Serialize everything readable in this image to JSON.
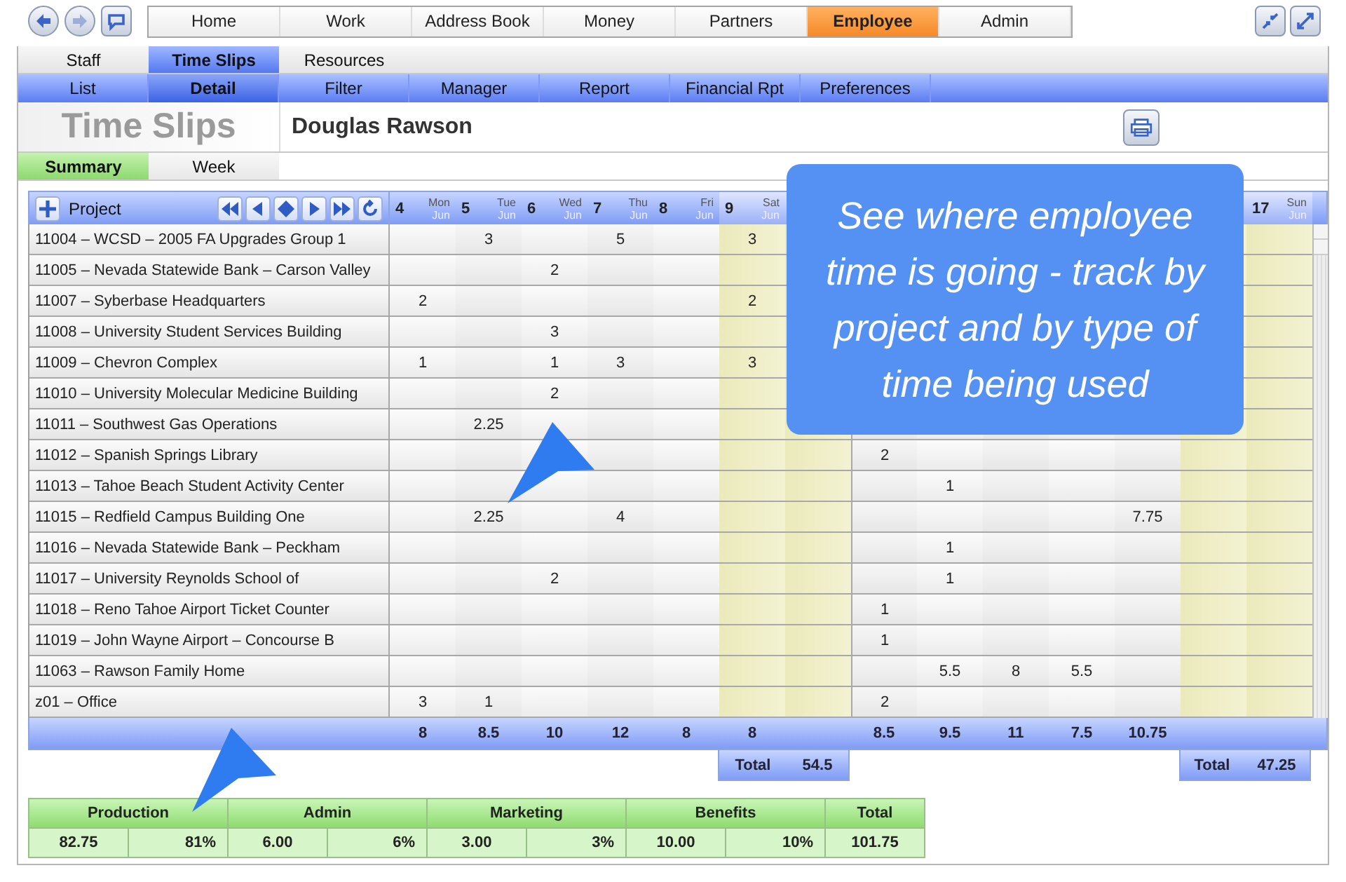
{
  "main_tabs": [
    {
      "label": "Home",
      "selected": false
    },
    {
      "label": "Work",
      "selected": false
    },
    {
      "label": "Address Book",
      "selected": false
    },
    {
      "label": "Money",
      "selected": false
    },
    {
      "label": "Partners",
      "selected": false
    },
    {
      "label": "Employee",
      "selected": true
    },
    {
      "label": "Admin",
      "selected": false
    }
  ],
  "sub_tabs": [
    {
      "label": "Staff",
      "selected": false
    },
    {
      "label": "Time Slips",
      "selected": true
    },
    {
      "label": "Resources",
      "selected": false
    }
  ],
  "view_tabs": [
    {
      "label": "List",
      "selected": false
    },
    {
      "label": "Detail",
      "selected": true
    },
    {
      "label": "Filter",
      "selected": false
    },
    {
      "label": "Manager",
      "selected": false
    },
    {
      "label": "Report",
      "selected": false
    },
    {
      "label": "Financial Rpt",
      "selected": false
    },
    {
      "label": "Preferences",
      "selected": false
    }
  ],
  "page_title": "Time Slips",
  "employee": "Douglas Rawson",
  "mode_tabs": [
    {
      "label": "Summary",
      "selected": true
    },
    {
      "label": "Week",
      "selected": false
    }
  ],
  "grid": {
    "project_header": "Project",
    "columns": [
      {
        "day": "4",
        "weekday": "Mon",
        "month": "Jun",
        "weekend": false
      },
      {
        "day": "5",
        "weekday": "Tue",
        "month": "Jun",
        "weekend": false
      },
      {
        "day": "6",
        "weekday": "Wed",
        "month": "Jun",
        "weekend": false
      },
      {
        "day": "7",
        "weekday": "Thu",
        "month": "Jun",
        "weekend": false
      },
      {
        "day": "8",
        "weekday": "Fri",
        "month": "Jun",
        "weekend": false
      },
      {
        "day": "9",
        "weekday": "Sat",
        "month": "Jun",
        "weekend": true
      },
      {
        "weekend": true
      },
      {
        "weekend": false
      },
      {
        "weekend": false
      },
      {
        "weekend": false
      },
      {
        "weekend": false
      },
      {
        "weekend": false
      },
      {
        "weekend": true
      },
      {
        "day": "17",
        "weekday": "Sun",
        "month": "Jun",
        "weekend": true
      }
    ],
    "rows": [
      {
        "project": "11004 – WCSD – 2005 FA Upgrades Group 1",
        "hours": {
          "c1": "3",
          "c3": "5",
          "c5": "3"
        }
      },
      {
        "project": "11005 – Nevada Statewide Bank – Carson Valley",
        "hours": {
          "c2": "2"
        }
      },
      {
        "project": "11007 – Syberbase Headquarters",
        "hours": {
          "c0": "2",
          "c5": "2"
        }
      },
      {
        "project": "11008 – University Student Services Building",
        "hours": {
          "c2": "3"
        }
      },
      {
        "project": "11009 – Chevron Complex",
        "hours": {
          "c0": "1",
          "c2": "1",
          "c3": "3",
          "c5": "3"
        }
      },
      {
        "project": "11010 – University Molecular Medicine Building",
        "hours": {
          "c2": "2"
        }
      },
      {
        "project": "11011 – Southwest Gas Operations",
        "hours": {
          "c1": "2.25"
        }
      },
      {
        "project": "11012 – Spanish Springs Library",
        "hours": {
          "c7": "2"
        }
      },
      {
        "project": "11013 – Tahoe Beach Student Activity Center",
        "hours": {
          "c8": "1"
        }
      },
      {
        "project": "11015 – Redfield Campus Building One",
        "hours": {
          "c1": "2.25",
          "c3": "4",
          "c11": "7.75"
        }
      },
      {
        "project": "11016 – Nevada Statewide Bank – Peckham",
        "hours": {
          "c8": "1"
        }
      },
      {
        "project": "11017 – University Reynolds School of",
        "hours": {
          "c2": "2",
          "c8": "1"
        }
      },
      {
        "project": "11018 – Reno Tahoe Airport Ticket Counter",
        "hours": {
          "c7": "1"
        }
      },
      {
        "project": "11019 – John Wayne Airport – Concourse B",
        "hours": {
          "c7": "1"
        }
      },
      {
        "project": "11063 – Rawson Family Home",
        "hours": {
          "c8": "5.5",
          "c9": "8",
          "c10": "5.5"
        }
      },
      {
        "project": "z01 – Office",
        "hours": {
          "c0": "3",
          "c1": "1",
          "c7": "2"
        }
      }
    ],
    "totals": {
      "c0": "8",
      "c1": "8.5",
      "c2": "10",
      "c3": "12",
      "c4": "8",
      "c5": "8",
      "c7": "8.5",
      "c8": "9.5",
      "c9": "11",
      "c10": "7.5",
      "c11": "10.75"
    },
    "week_totals": [
      {
        "label": "Total",
        "value": "54.5"
      },
      {
        "label": "Total",
        "value": "47.25"
      }
    ]
  },
  "summary": {
    "categories": [
      {
        "name": "Production",
        "hours": "82.75",
        "percent": "81%"
      },
      {
        "name": "Admin",
        "hours": "6.00",
        "percent": "6%"
      },
      {
        "name": "Marketing",
        "hours": "3.00",
        "percent": "3%"
      },
      {
        "name": "Benefits",
        "hours": "10.00",
        "percent": "10%"
      }
    ],
    "total": {
      "label": "Total",
      "value": "101.75"
    }
  },
  "callout": "See where employee time is going - track by project and by type of time being used"
}
